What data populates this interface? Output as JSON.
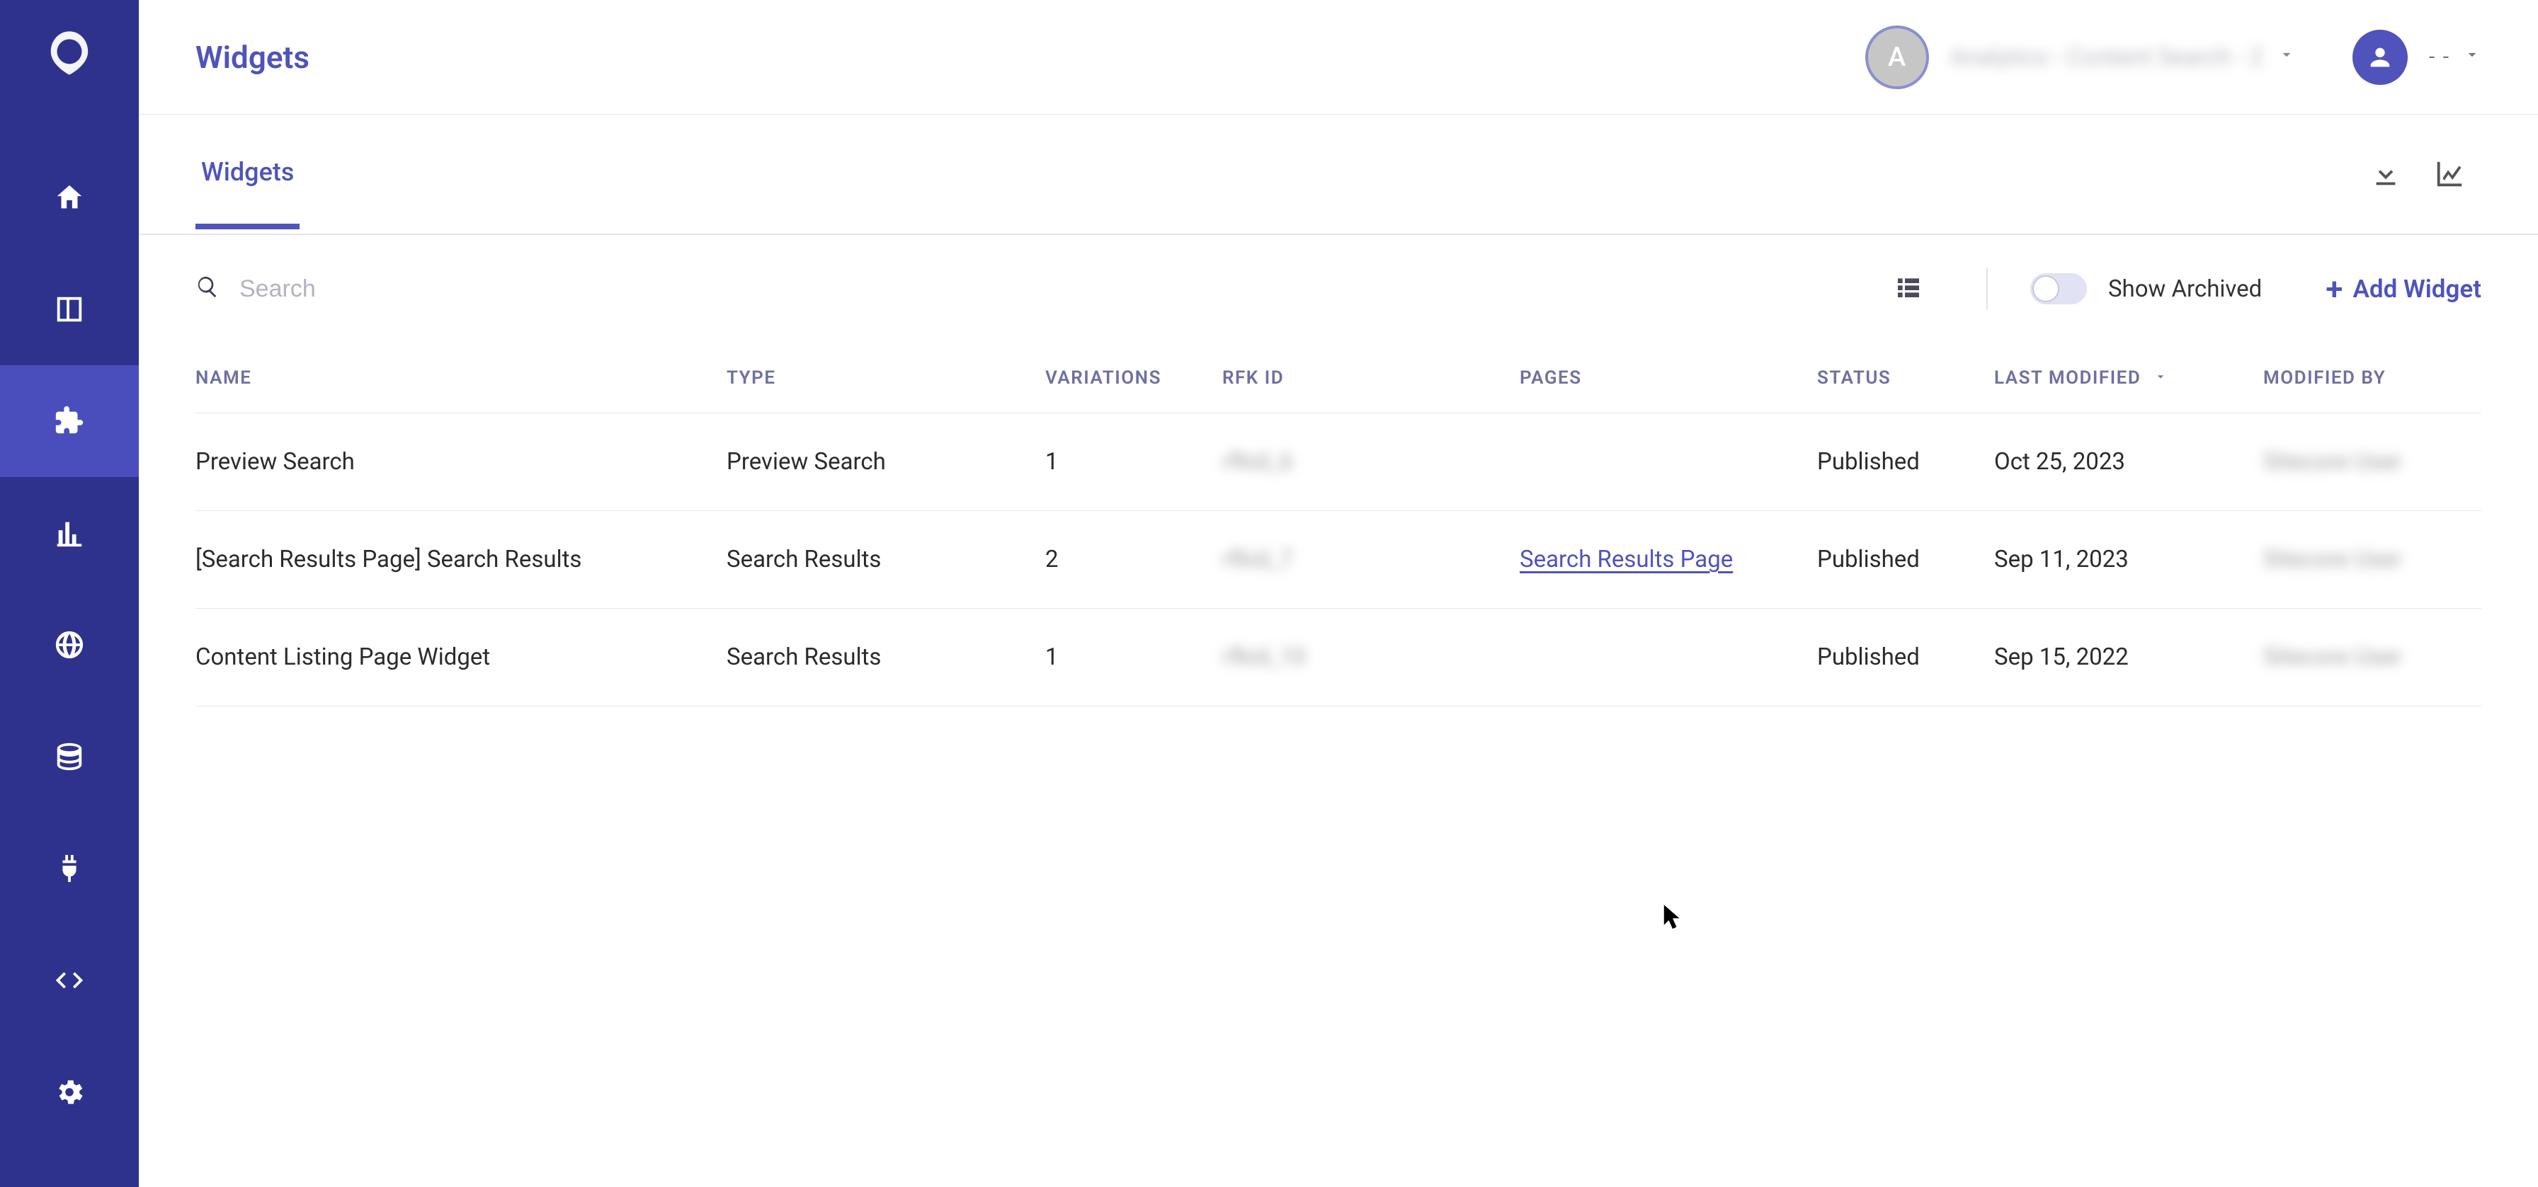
{
  "header": {
    "title": "Widgets",
    "env_letter": "A",
    "env_label": "Analytics - Content Search - 2",
    "user_label": "- -"
  },
  "tabs": {
    "active": "Widgets"
  },
  "toolbar": {
    "search_placeholder": "Search",
    "show_archived_label": "Show Archived",
    "add_button_label": "Add Widget"
  },
  "table": {
    "headers": {
      "name": "NAME",
      "type": "TYPE",
      "variations": "VARIATIONS",
      "rfk_id": "RFK ID",
      "pages": "PAGES",
      "status": "STATUS",
      "last_modified": "LAST MODIFIED",
      "modified_by": "MODIFIED BY"
    },
    "rows": [
      {
        "name": "Preview Search",
        "type": "Preview Search",
        "variations": "1",
        "rfk_id": "rfkid_6",
        "pages": "",
        "status": "Published",
        "last_modified": "Oct 25, 2023",
        "modified_by": "Sitecore User"
      },
      {
        "name": "[Search Results Page] Search Results",
        "type": "Search Results",
        "variations": "2",
        "rfk_id": "rfkid_7",
        "pages": "Search Results Page",
        "status": "Published",
        "last_modified": "Sep 11, 2023",
        "modified_by": "Sitecore User"
      },
      {
        "name": "Content Listing Page Widget",
        "type": "Search Results",
        "variations": "1",
        "rfk_id": "rfkid_10",
        "pages": "",
        "status": "Published",
        "last_modified": "Sep 15, 2022",
        "modified_by": "Sitecore User"
      }
    ]
  }
}
